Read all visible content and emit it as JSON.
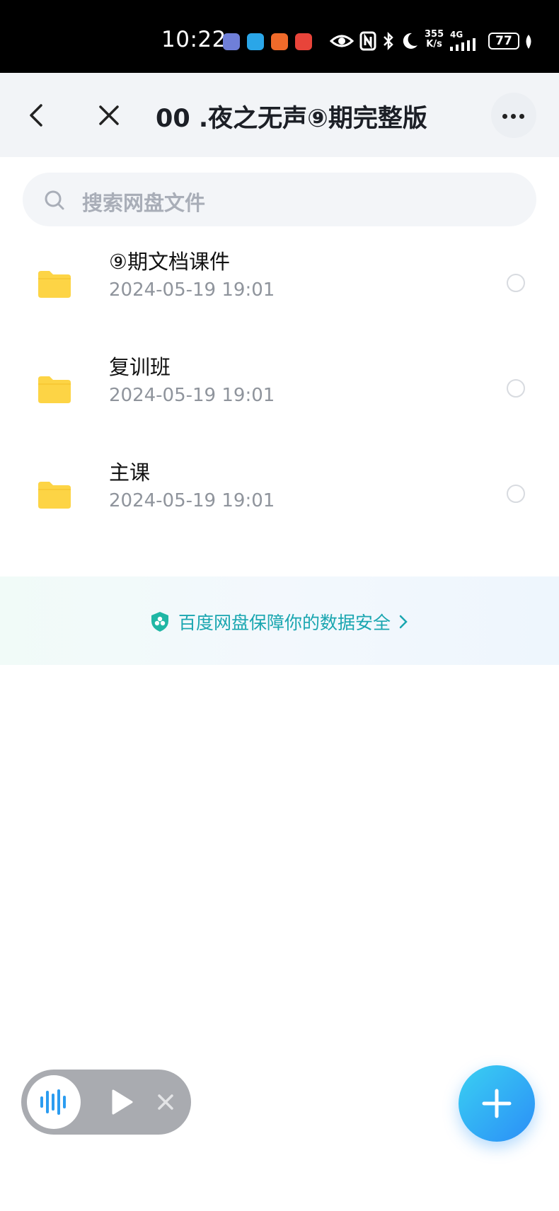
{
  "status_bar": {
    "time": "10:22",
    "net_speed_top": "355",
    "net_speed_bottom": "K/s",
    "network": "4G",
    "battery": "77"
  },
  "header": {
    "title": "00 .夜之无声⑨期完整版",
    "back_icon": "chevron-left-icon",
    "close_icon": "close-icon",
    "more_icon": "more-horizontal-icon"
  },
  "search": {
    "placeholder": "搜索网盘文件",
    "icon": "search-icon"
  },
  "files": [
    {
      "name": "⑨期文档课件",
      "date": "2024-05-19  19:01",
      "icon": "folder-icon"
    },
    {
      "name": "复训班",
      "date": "2024-05-19  19:01",
      "icon": "folder-icon"
    },
    {
      "name": "主课",
      "date": "2024-05-19  19:01",
      "icon": "folder-icon"
    }
  ],
  "banner": {
    "text": "百度网盘保障你的数据安全",
    "icon": "shield-icon"
  },
  "player": {
    "wave_icon": "audio-wave-icon",
    "play_icon": "play-icon",
    "close_icon": "close-icon"
  },
  "fab": {
    "icon": "plus-icon"
  },
  "colors": {
    "folder": "#fdd445",
    "accent": "#1aa6b0",
    "fab_start": "#3ad0f2",
    "fab_end": "#2b8ef7",
    "header_bg": "#f2f4f7"
  }
}
